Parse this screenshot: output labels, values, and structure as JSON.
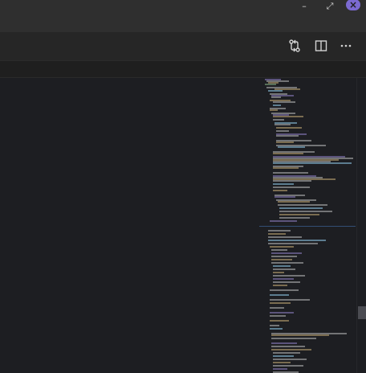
{
  "window": {
    "controls": {
      "minimize_glyph": "–",
      "restore_glyph": "⤢",
      "close_glyph": "×"
    }
  },
  "toolbar": {
    "icons": [
      "compare-changes-icon",
      "split-editor-icon",
      "more-actions-icon"
    ]
  },
  "colors": {
    "title_bar": "#2f2f2f",
    "toolbar": "#262626",
    "editor_bg": "#1d1e22",
    "close_accent": "#7b6ad1"
  }
}
